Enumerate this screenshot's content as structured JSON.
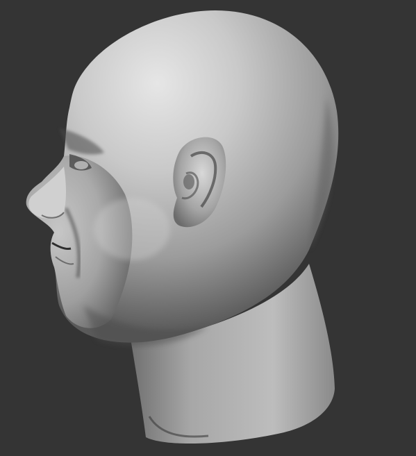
{
  "viewport": {
    "background_color": "#343434",
    "material_color": "#9a9a9a",
    "material_highlight": "#e4e4e4",
    "material_shadow": "#2a2a2a",
    "subject": "head-sculpt-side-profile"
  }
}
